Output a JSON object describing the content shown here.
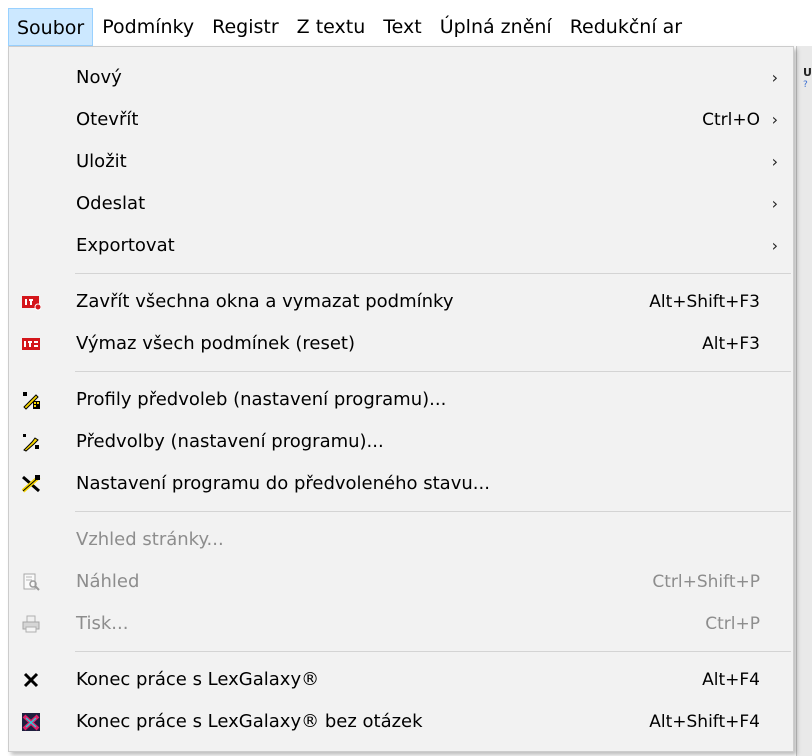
{
  "menubar": {
    "items": [
      "Soubor",
      "Podmínky",
      "Registr",
      "Z textu",
      "Text",
      "Úplná znění",
      "Redukční ar"
    ]
  },
  "menu": {
    "new": {
      "label": "Nový"
    },
    "open": {
      "label": "Otevřít",
      "shortcut": "Ctrl+O"
    },
    "save": {
      "label": "Uložit"
    },
    "send": {
      "label": "Odeslat"
    },
    "export": {
      "label": "Exportovat"
    },
    "close_all": {
      "label": "Zavřít všechna okna a vymazat podmínky",
      "shortcut": "Alt+Shift+F3"
    },
    "reset": {
      "label": "Výmaz všech podmínek (reset)",
      "shortcut": "Alt+F3"
    },
    "profiles": {
      "label": "Profily předvoleb (nastavení programu)..."
    },
    "preferences": {
      "label": "Předvolby (nastavení programu)..."
    },
    "defaults": {
      "label": "Nastavení programu do předvoleného stavu..."
    },
    "page_setup": {
      "label": "Vzhled stránky..."
    },
    "preview": {
      "label": "Náhled",
      "shortcut": "Ctrl+Shift+P"
    },
    "print": {
      "label": "Tisk...",
      "shortcut": "Ctrl+P"
    },
    "quit": {
      "label": "Konec práce s LexGalaxy®",
      "shortcut": "Alt+F4"
    },
    "quit_force": {
      "label": "Konec práce s LexGalaxy® bez otázek",
      "shortcut": "Alt+Shift+F4"
    }
  },
  "icons": {
    "close_all": "close-all-red-icon",
    "reset": "reset-red-icon",
    "profiles": "profiles-wrench-icon",
    "preferences": "preferences-wrench-icon",
    "defaults": "defaults-tools-icon",
    "preview": "preview-icon",
    "print": "print-icon",
    "quit": "x-icon",
    "quit_force": "quit-force-icon"
  },
  "colors": {
    "menu_bg": "#f2f2f2",
    "active_tab": "#cce8ff",
    "disabled_text": "#8d8d8d",
    "red_icon": "#d4161b",
    "yellow_icon": "#f6d500"
  }
}
